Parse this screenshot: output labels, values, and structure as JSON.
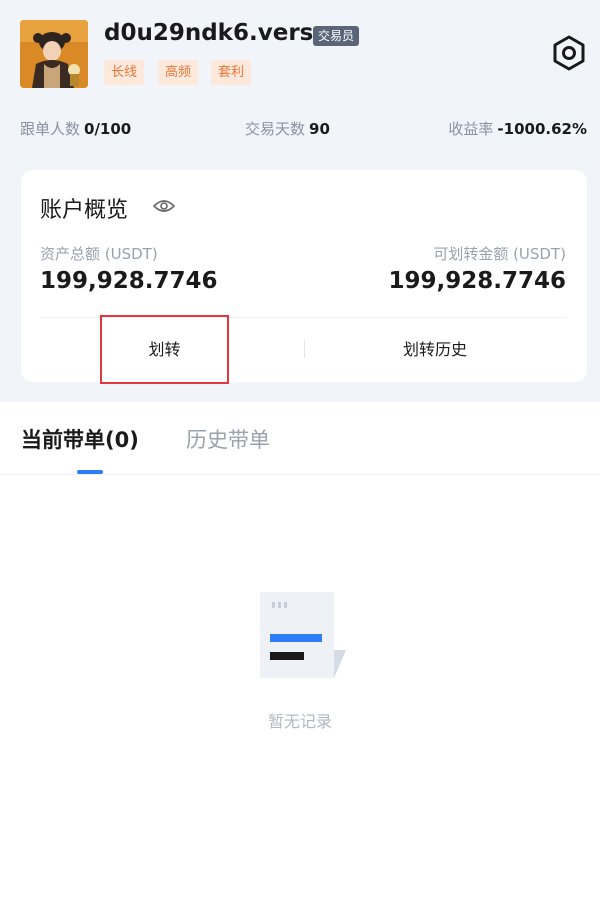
{
  "profile": {
    "name": "d0u29ndk6.verse",
    "role_badge": "交易员",
    "tags": [
      "长线",
      "高频",
      "套利"
    ]
  },
  "stats": [
    {
      "label": "跟单人数",
      "value": "0/100"
    },
    {
      "label": "交易天数",
      "value": "90"
    },
    {
      "label": "收益率",
      "value": "-1000.62%"
    }
  ],
  "account": {
    "title": "账户概览",
    "total_label": "资产总额 (USDT)",
    "total_value": "199,928.7746",
    "transferable_label": "可划转金额 (USDT)",
    "transferable_value": "199,928.7746",
    "transfer_button": "划转",
    "history_button": "划转历史"
  },
  "tabs": {
    "current": "当前带单(0)",
    "history": "历史带单"
  },
  "empty_text": "暂无记录",
  "colors": {
    "accent": "#2d7df6",
    "tag_bg": "#fde9dc",
    "tag_text": "#e4773c",
    "highlight_border": "#e0383e"
  }
}
